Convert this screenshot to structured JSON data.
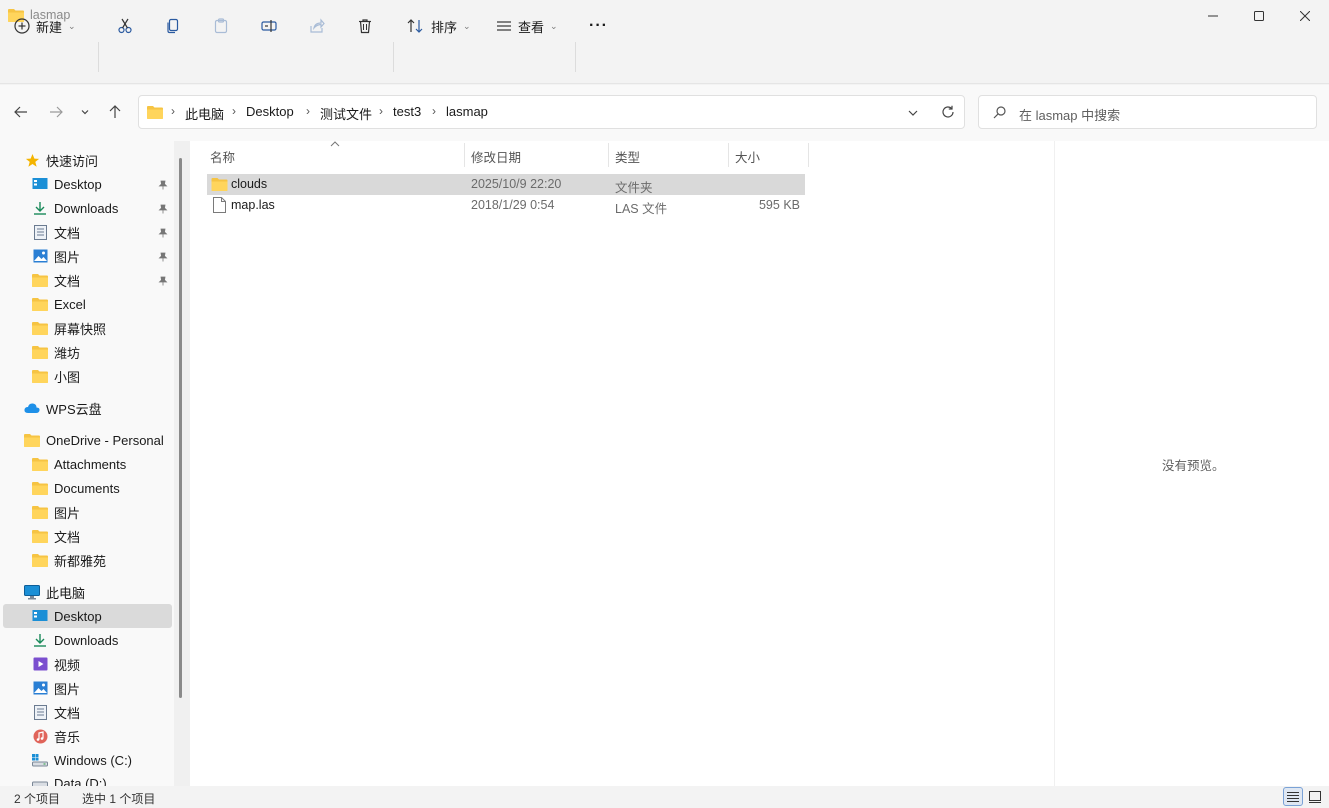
{
  "window": {
    "title": "lasmap"
  },
  "commandbar": {
    "new_label": "新建",
    "sort_label": "排序",
    "view_label": "查看",
    "more_label": "···"
  },
  "address": {
    "crumbs": [
      "此电脑",
      "Desktop",
      "测试文件",
      "test3",
      "lasmap"
    ],
    "search_placeholder": "在 lasmap 中搜索"
  },
  "sidebar": {
    "quick_access": "快速访问",
    "quick_items": [
      {
        "label": "Desktop",
        "icon": "desktop-icon",
        "pinned": true
      },
      {
        "label": "Downloads",
        "icon": "download-icon",
        "pinned": true
      },
      {
        "label": "文档",
        "icon": "document-icon",
        "pinned": true
      },
      {
        "label": "图片",
        "icon": "picture-icon",
        "pinned": true
      },
      {
        "label": "文档",
        "icon": "folder-icon",
        "pinned": true
      },
      {
        "label": "Excel",
        "icon": "folder-icon",
        "pinned": false
      },
      {
        "label": "屏幕快照",
        "icon": "folder-icon",
        "pinned": false
      },
      {
        "label": "潍坊",
        "icon": "folder-icon",
        "pinned": false
      },
      {
        "label": "小图",
        "icon": "folder-icon",
        "pinned": false
      }
    ],
    "wps": "WPS云盘",
    "onedrive": "OneDrive - Personal",
    "onedrive_items": [
      "Attachments",
      "Documents",
      "图片",
      "文档",
      "新都雅苑"
    ],
    "this_pc": "此电脑",
    "pc_items": [
      {
        "label": "Desktop",
        "icon": "desktop-icon",
        "selected": true
      },
      {
        "label": "Downloads",
        "icon": "download-icon",
        "selected": false
      },
      {
        "label": "视频",
        "icon": "video-icon",
        "selected": false
      },
      {
        "label": "图片",
        "icon": "picture-icon",
        "selected": false
      },
      {
        "label": "文档",
        "icon": "document-icon",
        "selected": false
      },
      {
        "label": "音乐",
        "icon": "music-icon",
        "selected": false
      },
      {
        "label": "Windows (C:)",
        "icon": "drive-icon",
        "selected": false
      },
      {
        "label": "Data (D:)",
        "icon": "drive-icon",
        "selected": false
      }
    ]
  },
  "columns": {
    "name": "名称",
    "modified": "修改日期",
    "type": "类型",
    "size": "大小"
  },
  "files": [
    {
      "name": "clouds",
      "modified": "2025/10/9 22:20",
      "type": "文件夹",
      "size": "",
      "icon": "folder-icon",
      "selected": true
    },
    {
      "name": "map.las",
      "modified": "2018/1/29 0:54",
      "type": "LAS 文件",
      "size": "595 KB",
      "icon": "file-icon",
      "selected": false
    }
  ],
  "preview": {
    "text": "没有预览。"
  },
  "status": {
    "count": "2 个项目",
    "selection": "选中 1 个项目"
  },
  "colors": {
    "folder": "#f6c443",
    "accent": "#0067c0",
    "selection": "#d9d9d9"
  }
}
